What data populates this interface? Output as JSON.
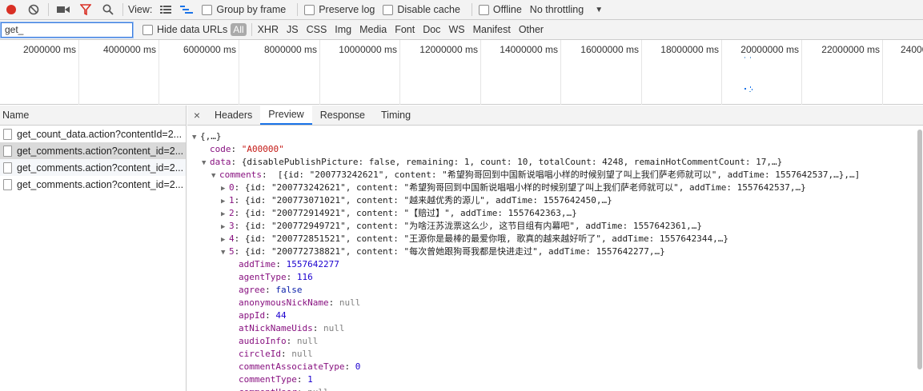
{
  "toolbar": {
    "view_label": "View:",
    "group_by_frame": "Group by frame",
    "preserve_log": "Preserve log",
    "disable_cache": "Disable cache",
    "offline": "Offline",
    "throttling": "No throttling"
  },
  "filter": {
    "value": "get_",
    "hide_data_urls": "Hide data URLs",
    "all": "All",
    "types": [
      "XHR",
      "JS",
      "CSS",
      "Img",
      "Media",
      "Font",
      "Doc",
      "WS",
      "Manifest",
      "Other"
    ]
  },
  "overview": {
    "ticks": [
      "2000000 ms",
      "4000000 ms",
      "6000000 ms",
      "8000000 ms",
      "10000000 ms",
      "12000000 ms",
      "14000000 ms",
      "16000000 ms",
      "18000000 ms",
      "20000000 ms",
      "22000000 ms",
      "24000"
    ]
  },
  "requests": {
    "header": "Name",
    "rows": [
      "get_count_data.action?contentId=2...",
      "get_comments.action?content_id=2...",
      "get_comments.action?content_id=2...",
      "get_comments.action?content_id=2..."
    ]
  },
  "tabs": {
    "close": "×",
    "headers": "Headers",
    "preview": "Preview",
    "response": "Response",
    "timing": "Timing"
  },
  "preview": {
    "root": "{,…}",
    "code_key": "code",
    "code_val": "\"A00000\"",
    "data_key": "data",
    "data_summary": "{disablePublishPicture: false, remaining: 1, count: 10, totalCount: 4248, remainHotCommentCount: 17,…}",
    "comments_key": "comments",
    "comments_summary": "[{id: \"200773242621\", content: \"希望狗哥回到中国新说唱唱小样的时候别望了叫上我们萨老师就可以\", addTime: 1557642537,…},…]",
    "items": [
      {
        "idx": "0",
        "summary": "{id: \"200773242621\", content: \"希望狗哥回到中国新说唱唱小样的时候别望了叫上我们萨老师就可以\", addTime: 1557642537,…}"
      },
      {
        "idx": "1",
        "summary": "{id: \"200773071021\", content: \"越来越优秀的源儿\", addTime: 1557642450,…}"
      },
      {
        "idx": "2",
        "summary": "{id: \"200772914921\", content: \"【赔过】\", addTime: 1557642363,…}"
      },
      {
        "idx": "3",
        "summary": "{id: \"200772949721\", content: \"为啥汪苏泷票这么少, 这节目组有内幕吧\", addTime: 1557642361,…}"
      },
      {
        "idx": "4",
        "summary": "{id: \"200772851521\", content: \"王源你是最棒的最爱你哦, 歌真的越来越好听了\", addTime: 1557642344,…}"
      },
      {
        "idx": "5",
        "summary": "{id: \"200772738821\", content: \"每次曾她跟狗哥我都是快进走过\", addTime: 1557642277,…}"
      }
    ],
    "props": [
      {
        "key": "addTime",
        "val": "1557642277",
        "type": "n"
      },
      {
        "key": "agentType",
        "val": "116",
        "type": "n"
      },
      {
        "key": "agree",
        "val": "false",
        "type": "b"
      },
      {
        "key": "anonymousNickName",
        "val": "null",
        "type": "nl"
      },
      {
        "key": "appId",
        "val": "44",
        "type": "n"
      },
      {
        "key": "atNickNameUids",
        "val": "null",
        "type": "nl"
      },
      {
        "key": "audioInfo",
        "val": "null",
        "type": "nl"
      },
      {
        "key": "circleId",
        "val": "null",
        "type": "nl"
      },
      {
        "key": "commentAssociateType",
        "val": "0",
        "type": "n"
      },
      {
        "key": "commentType",
        "val": "1",
        "type": "n"
      },
      {
        "key": "commentUser",
        "val": "null",
        "type": "nl"
      }
    ]
  }
}
